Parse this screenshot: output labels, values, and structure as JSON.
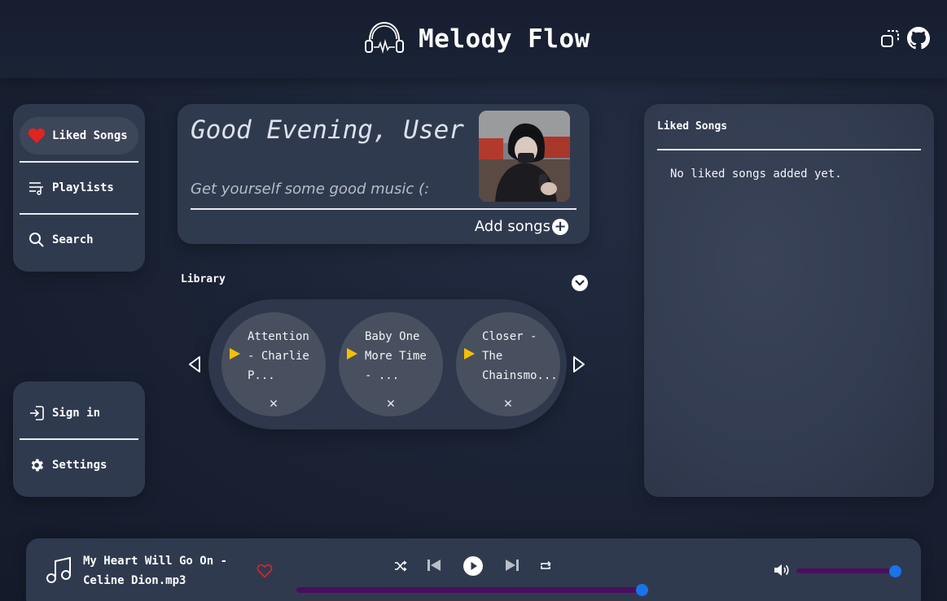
{
  "header": {
    "title": "Melody Flow",
    "logo_icon": "headphones-icon",
    "right_icons": [
      "copy-window-icon",
      "github-icon"
    ]
  },
  "nav_top": {
    "items": [
      {
        "label": "Liked Songs",
        "icon": "heart-icon",
        "active": true
      },
      {
        "label": "Playlists",
        "icon": "playlist-icon"
      },
      {
        "label": "Search",
        "icon": "search-icon"
      }
    ]
  },
  "nav_bottom": {
    "items": [
      {
        "label": "Sign in",
        "icon": "sign-in-icon"
      },
      {
        "label": "Settings",
        "icon": "gear-icon"
      }
    ]
  },
  "greeting": {
    "title": "Good Evening, User",
    "subtitle": "Get yourself some good music (:",
    "add_songs_label": "Add songs"
  },
  "library": {
    "label": "Library",
    "songs": [
      {
        "title": "Attention\n- Charlie\nP..."
      },
      {
        "title": "Baby One\nMore Time\n- ..."
      },
      {
        "title": "Closer -\nThe\nChainsmo..."
      }
    ],
    "remove_symbol": "✕"
  },
  "liked_panel": {
    "title": "Liked Songs",
    "empty_text": "No liked songs added yet."
  },
  "player": {
    "now_playing": "My Heart Will Go On - Celine Dion.mp3",
    "progress": 0.99,
    "volume": 0.99,
    "colors": {
      "track": "#4a0e5e",
      "thumb": "#1a73e8",
      "heart": "#e02424",
      "play_triangle": "#f5c000"
    }
  }
}
